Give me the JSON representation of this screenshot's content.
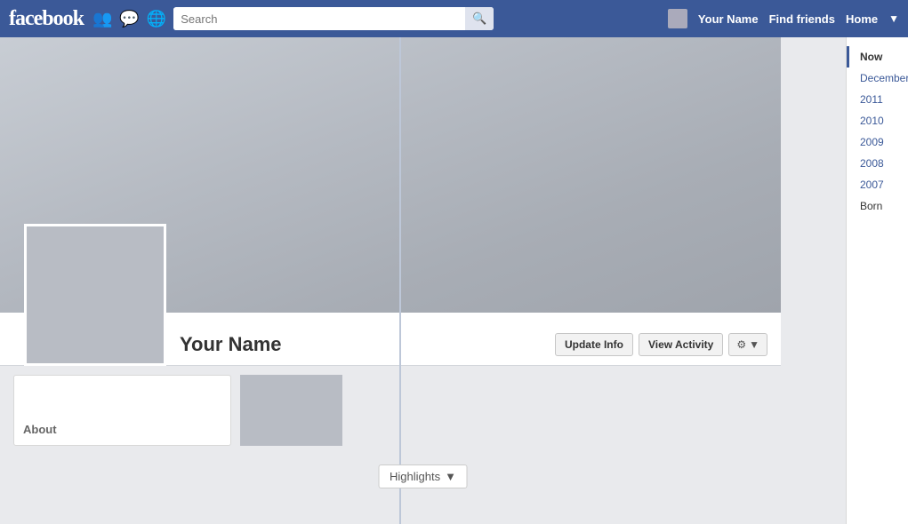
{
  "nav": {
    "logo": "facebook",
    "search_placeholder": "Search",
    "search_button_icon": "🔍",
    "username": "Your Name",
    "find_friends": "Find friends",
    "home": "Home",
    "dropdown_icon": "▼"
  },
  "profile": {
    "name": "Your Name",
    "update_info_label": "Update Info",
    "view_activity_label": "View Activity",
    "gear_icon": "⚙",
    "dropdown_icon": "▼"
  },
  "about": {
    "label": "About"
  },
  "timeline": {
    "items": [
      {
        "label": "Now",
        "active": true
      },
      {
        "label": "December",
        "active": false
      },
      {
        "label": "2011",
        "active": false
      },
      {
        "label": "2010",
        "active": false
      },
      {
        "label": "2009",
        "active": false
      },
      {
        "label": "2008",
        "active": false
      },
      {
        "label": "2007",
        "active": false
      },
      {
        "label": "Born",
        "active": false
      }
    ]
  },
  "highlights": {
    "label": "Highlights",
    "dropdown_icon": "▼"
  }
}
